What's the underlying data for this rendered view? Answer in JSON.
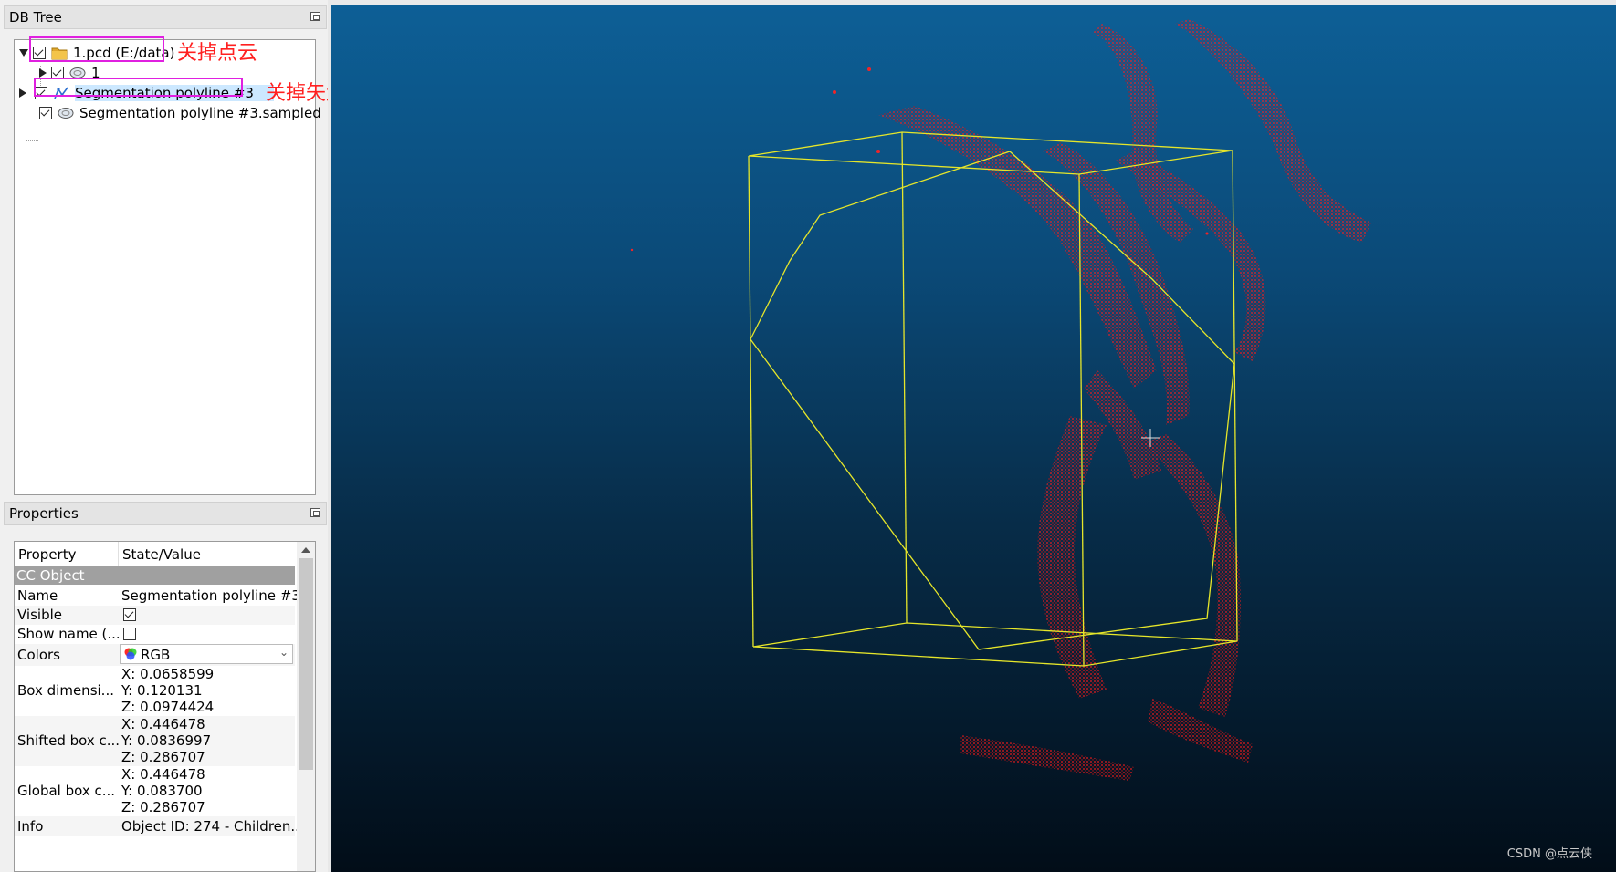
{
  "db_tree": {
    "title": "DB Tree",
    "items": [
      {
        "label": "1.pcd (E:/data)",
        "checked": true,
        "icon": "folder-icon",
        "expanded": true
      },
      {
        "label": "1",
        "checked": true,
        "icon": "point-cloud-icon"
      },
      {
        "label": "Segmentation polyline #3",
        "checked": true,
        "icon": "polyline-icon",
        "selected": true
      },
      {
        "label": "Segmentation polyline #3.sampled",
        "checked": true,
        "icon": "point-cloud-icon"
      }
    ],
    "annotations": [
      "关掉点云",
      "关掉矢量线"
    ]
  },
  "properties": {
    "title": "Properties",
    "col_property": "Property",
    "col_value": "State/Value",
    "section": "CC Object",
    "rows": {
      "name": {
        "key": "Name",
        "value": "Segmentation polyline #3"
      },
      "visible": {
        "key": "Visible",
        "checked": true
      },
      "show_name": {
        "key": "Show name (...",
        "checked": false
      },
      "colors": {
        "key": "Colors",
        "value": "RGB"
      },
      "box_dim": {
        "key": "Box dimensi...",
        "x": "X: 0.0658599",
        "y": "Y: 0.120131",
        "z": "Z: 0.0974424"
      },
      "shifted_box": {
        "key": "Shifted box c...",
        "x": "X: 0.446478",
        "y": "Y: 0.0836997",
        "z": "Z: 0.286707"
      },
      "global_box": {
        "key": "Global box c...",
        "x": "X: 0.446478",
        "y": "Y: 0.083700",
        "z": "Z: 0.286707"
      },
      "info": {
        "key": "Info",
        "value": "Object ID: 274 - Children..."
      }
    }
  },
  "view": {
    "watermark": "CSDN @点云侠",
    "colors": {
      "bbox": "#e6e62a",
      "points": "#ff1a1a",
      "background_top": "#0d5f96",
      "background_bottom": "#020d18"
    }
  }
}
